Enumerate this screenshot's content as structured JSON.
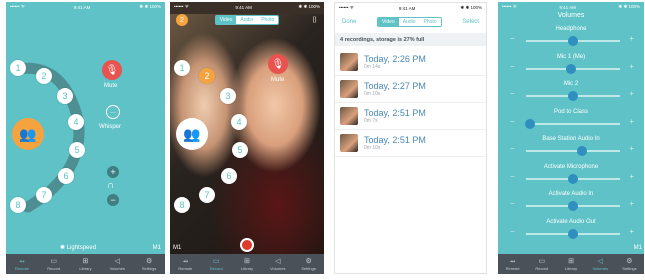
{
  "status": {
    "carrier": "•••••• ᯤ",
    "time": "9:41 AM",
    "battery": "✱ ✱ 100%"
  },
  "tabs": [
    {
      "icon": "⥇",
      "label": "Remote"
    },
    {
      "icon": "▭",
      "label": "Record"
    },
    {
      "icon": "⊞",
      "label": "Library"
    },
    {
      "icon": "◁",
      "label": "Volumes"
    },
    {
      "icon": "⚙",
      "label": "Settings"
    }
  ],
  "panel1": {
    "numbers": [
      "1",
      "2",
      "3",
      "4",
      "5",
      "6",
      "7",
      "8"
    ],
    "mute_label": "Mute",
    "whisper_label": "Whisper",
    "brand": "Lightspeed",
    "mic_indicator": "M1"
  },
  "panel2": {
    "badge": "2",
    "modes": [
      "Video",
      "Audio",
      "Photo"
    ],
    "selected_mode": "Video",
    "mute_label": "Mute",
    "mic_indicator": "M1"
  },
  "panel3": {
    "done": "Done",
    "select": "Select",
    "modes": [
      "Video",
      "Audio",
      "Photo"
    ],
    "banner": "4 recordings, storage is 27% full",
    "recordings": [
      {
        "title": "Today, 2:26 PM",
        "duration": "0m 14s"
      },
      {
        "title": "Today, 2:27 PM",
        "duration": "0m 10s"
      },
      {
        "title": "Today, 2:51 PM",
        "duration": "0m 7s"
      },
      {
        "title": "Today, 2:51 PM",
        "duration": "0m 10s"
      }
    ]
  },
  "panel4": {
    "title": "Volumes",
    "volumes": [
      {
        "name": "Headphone",
        "level": 0.5
      },
      {
        "name": "Mic 1 (Me)",
        "level": 0.48
      },
      {
        "name": "Mic 2",
        "level": 0.5
      },
      {
        "name": "Pod to Class",
        "level": 0.04
      },
      {
        "name": "Base Station Audio In",
        "level": 0.6
      },
      {
        "name": "Activate Microphone",
        "level": 0.5
      },
      {
        "name": "Activate Audio In",
        "level": 0.5
      },
      {
        "name": "Activate Audio Out",
        "level": 0.5
      }
    ],
    "mic_indicator": "M1"
  },
  "colors": {
    "teal": "#5ec2c6",
    "orange": "#f4a33f",
    "red": "#e8524f",
    "tabbar": "#4b5159",
    "knob": "#2f8fbf"
  }
}
